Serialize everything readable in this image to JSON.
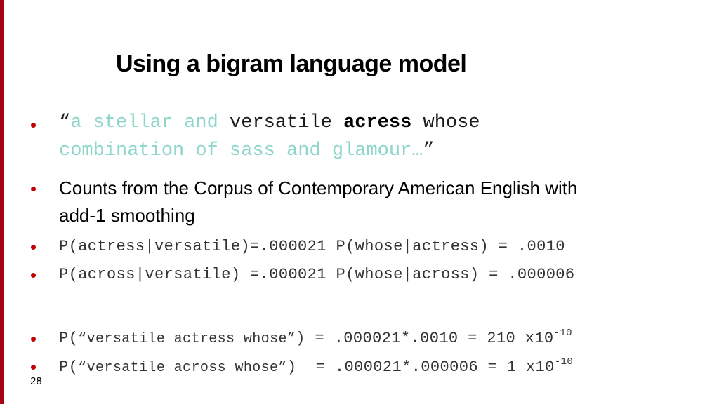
{
  "slide": {
    "title": "Using a bigram language model",
    "page_number": "28",
    "colors": {
      "accent_bar": "#a50012",
      "bullet": "#c00000",
      "teal_text": "#8dd6c9"
    },
    "sentence_bullet": {
      "open_quote": "“",
      "part1_teal": "a stellar and",
      "part2_plain": " versatile ",
      "part3_bold": "acress",
      "part4_plain": " whose",
      "line2_teal": "combination of sass and glamour…",
      "close_quote": "”"
    },
    "counts_bullet": {
      "line1": "Counts from the Corpus of Contemporary American English with",
      "line2": "add-1 smoothing"
    },
    "prob_bullets": [
      "P(actress|versatile)=.000021 P(whose|actress) = .0010",
      "P(across|versatile) =.000021 P(whose|across) = .000006"
    ],
    "joint_bullets": [
      {
        "prefix": "P(",
        "quoted": "“versatile actress whose”",
        "suffix": ") = .000021*.0010 = 210 x10",
        "exponent": "-10"
      },
      {
        "prefix": "P(",
        "quoted": "“versatile across whose”",
        "suffix": ")  = .000021*.000006 = 1 x10",
        "exponent": "-10"
      }
    ]
  }
}
